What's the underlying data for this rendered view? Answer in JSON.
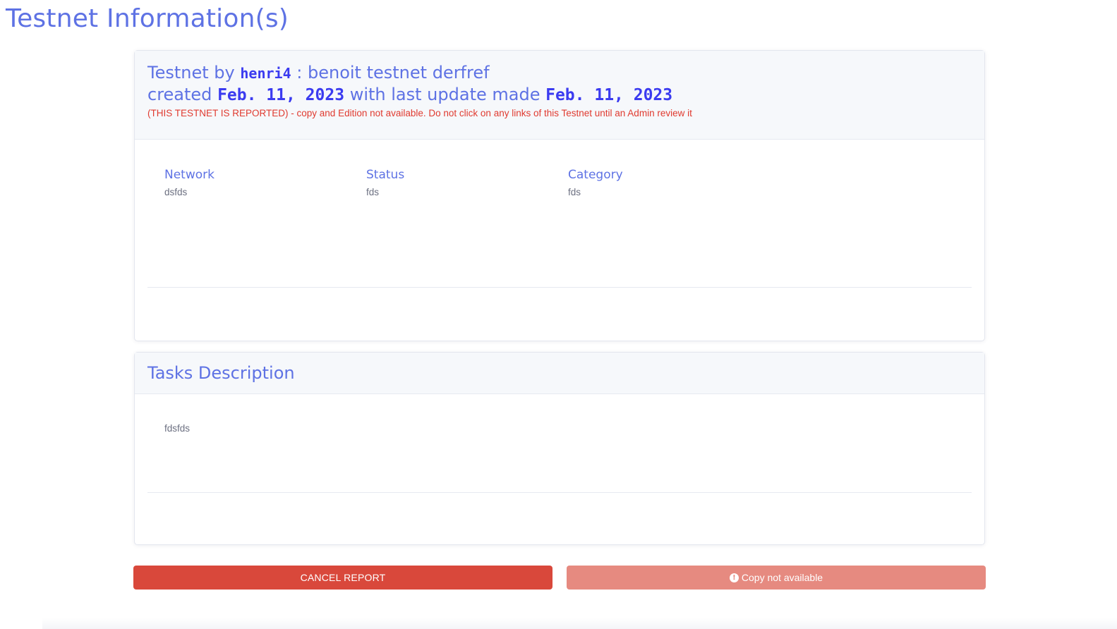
{
  "page": {
    "title": "Testnet Information(s)"
  },
  "testnet_card": {
    "line1_prefix": "Testnet by",
    "author": "henri4",
    "line1_separator": ":",
    "name": "benoit testnet derfref",
    "line2_prefix": "created",
    "created_date": "Feb. 11, 2023",
    "line2_middle": "with last update made",
    "updated_date": "Feb. 11, 2023",
    "warning": "(THIS TESTNET IS REPORTED) - copy and Edition not available. Do not click on any links of this Testnet until an Admin review it",
    "fields": [
      {
        "label": "Network",
        "value": "dsfds"
      },
      {
        "label": "Status",
        "value": "fds"
      },
      {
        "label": "Category",
        "value": "fds"
      }
    ]
  },
  "tasks_card": {
    "title": "Tasks Description",
    "body": "fdsfds"
  },
  "actions": {
    "cancel_report_label": "CANCEL REPORT",
    "copy_label": "Copy not available",
    "copy_icon": "info-circle-icon"
  },
  "colors": {
    "primary": "#5e72e4",
    "accent_mono": "#3b3bf0",
    "danger": "#d9483b",
    "danger_light": "#e68a80",
    "warning_text": "#e03a2f"
  }
}
